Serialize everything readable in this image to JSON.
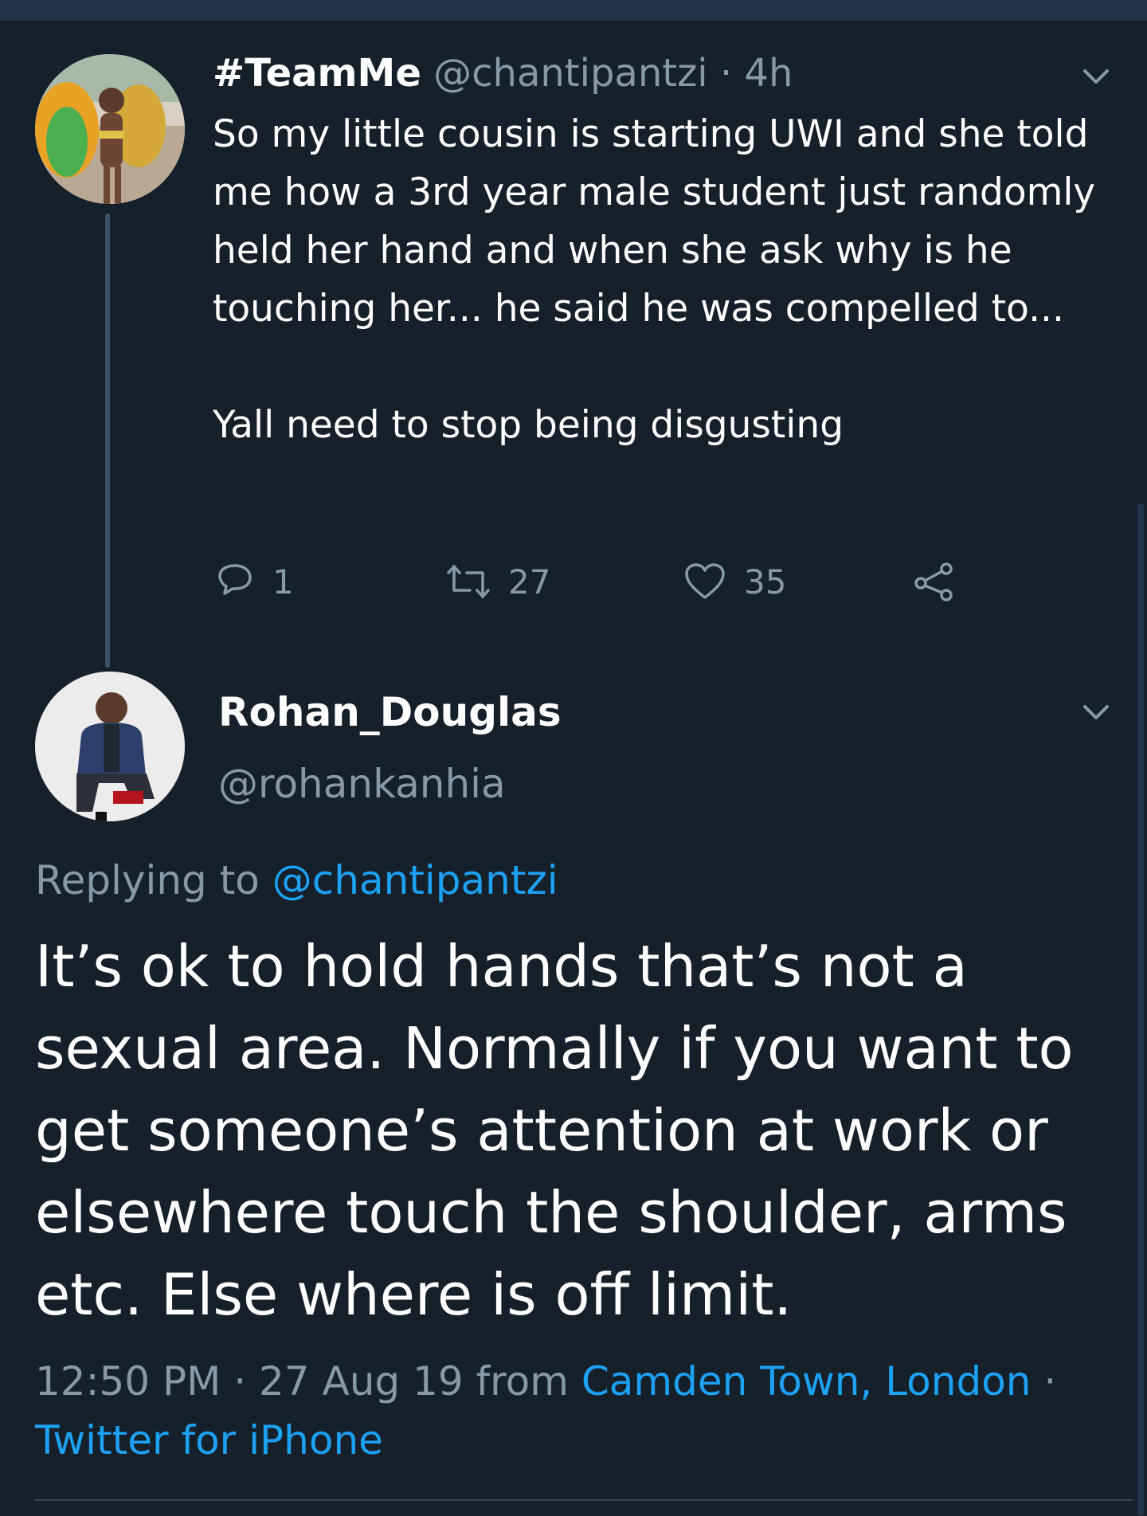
{
  "tweet1": {
    "display_name": "#TeamMe",
    "handle": "@chantipantzi",
    "separator": "·",
    "time": "4h",
    "body_lines": [
      "So my little cousin is starting UWI and she told me how a 3rd year male student just randomly held her hand and when she ask why is he touching her... he said he was compelled to...",
      "Yall need to stop being disgusting"
    ],
    "actions": {
      "reply_count": "1",
      "retweet_count": "27",
      "like_count": "35"
    }
  },
  "tweet2": {
    "display_name": "Rohan_Douglas",
    "handle": "@rohankanhia",
    "replying_prefix": "Replying to",
    "replying_to": "@chantipantzi",
    "body": "It’s ok to hold hands that’s not a sexual area. Normally if you want to get someone’s attention at work or elsewhere touch the shoulder, arms etc. Else where is off limit.",
    "meta": {
      "time": "12:50 PM",
      "sep1": "·",
      "date": "27 Aug 19",
      "from_word": "from",
      "location": "Camden Town, London",
      "sep2": "·",
      "source": "Twitter for iPhone"
    }
  },
  "icons": {
    "tweet1_avatar": "avatar-photo-carnival",
    "tweet2_avatar": "avatar-photo-man-suit",
    "menu": "chevron-down-icon",
    "reply": "reply-icon",
    "retweet": "retweet-icon",
    "like": "heart-icon",
    "share": "share-icon"
  },
  "colors": {
    "background": "#15202b",
    "secondary_text": "#8899a6",
    "link": "#1da1f2",
    "thread_line": "#3d5466"
  }
}
